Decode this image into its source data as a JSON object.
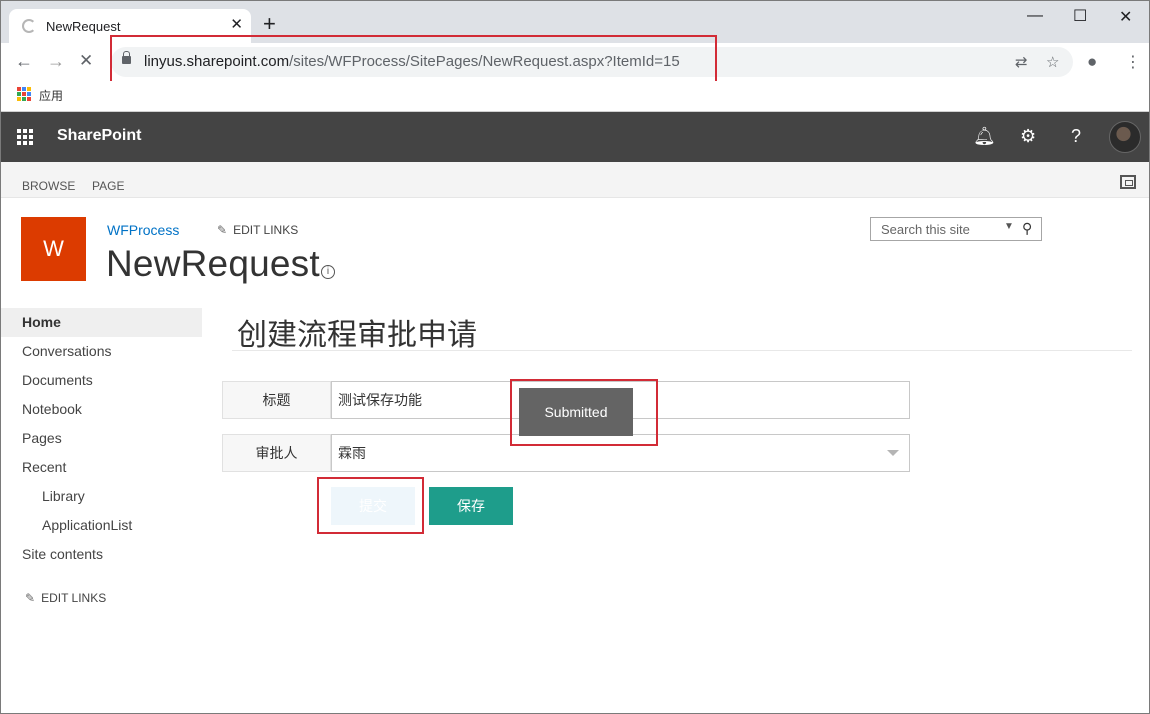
{
  "browser": {
    "tab_title": "NewRequest",
    "url_host": "linyus.sharepoint.com",
    "url_path": "/sites/WFProcess/SitePages/NewRequest.aspx?ItemId=15",
    "bookmarks_apps_label": "应用"
  },
  "suite": {
    "brand": "SharePoint"
  },
  "ribbon": {
    "tabs": [
      "BROWSE",
      "PAGE"
    ]
  },
  "site": {
    "logo_letter": "W",
    "site_name": "WFProcess",
    "edit_links_label": "EDIT LINKS",
    "page_title": "NewRequest",
    "search_placeholder": "Search this site"
  },
  "nav": {
    "items": [
      "Home",
      "Conversations",
      "Documents",
      "Notebook",
      "Pages",
      "Recent",
      "Library",
      "ApplicationList",
      "Site contents"
    ],
    "edit_links_label": "EDIT LINKS"
  },
  "form": {
    "heading": "创建流程审批申请",
    "title_label": "标题",
    "title_value": "测试保存功能",
    "approver_label": "审批人",
    "approver_value": "霖雨",
    "submit_label": "提交",
    "save_label": "保存",
    "tooltip": "Submitted"
  },
  "colors": {
    "suitebar": "#444444",
    "logo": "#dc3b00",
    "site_link": "#0072c6",
    "save_button": "#1e9d8b",
    "annotation_box": "#d22b36"
  }
}
